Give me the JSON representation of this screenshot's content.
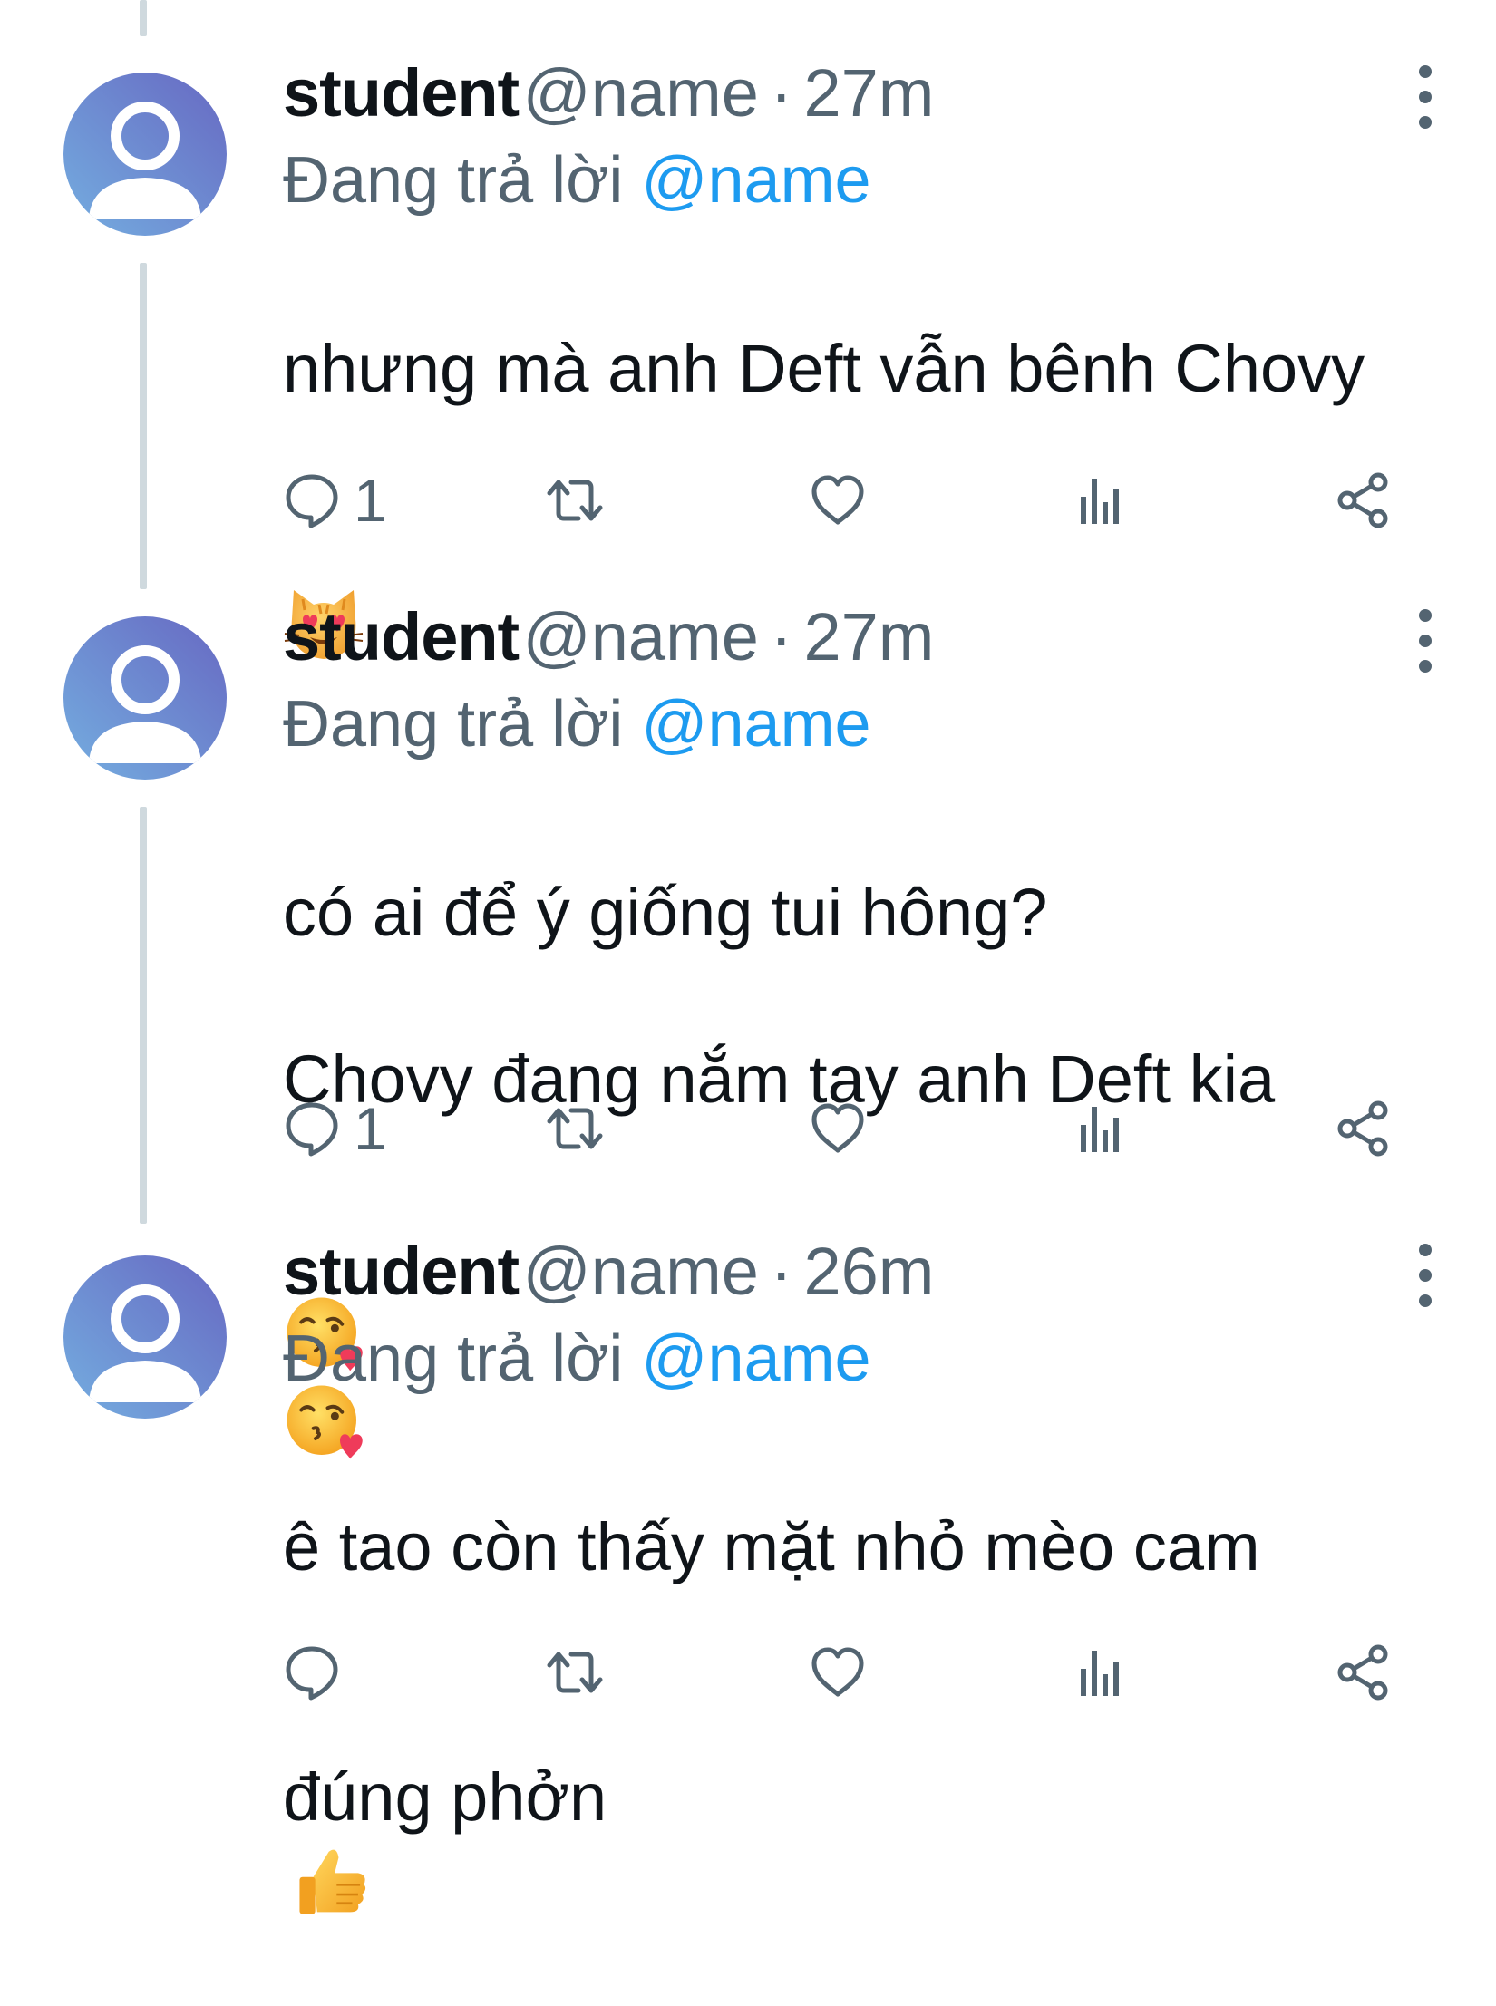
{
  "tweets": [
    {
      "name": "student",
      "handle": "@name",
      "time": "27m",
      "reply_prefix": "Đang trả lời",
      "reply_handle": "@name",
      "text": "nhưng mà anh Deft vẫn bênh Chovy",
      "emojis": [
        "smiling-cat-heart-eyes-emoji"
      ],
      "reply_count": "1",
      "icons": [
        "reply-icon",
        "retweet-icon",
        "like-icon",
        "analytics-icon",
        "share-icon"
      ]
    },
    {
      "name": "student",
      "handle": "@name",
      "time": "27m",
      "reply_prefix": "Đang trả lời",
      "reply_handle": "@name",
      "text_line1": "có ai để ý giống tui hông?",
      "text_line2": "Chovy đang nắm tay anh Deft kia",
      "emojis": [
        "face-blowing-kiss-emoji",
        "face-blowing-kiss-emoji"
      ],
      "reply_count": "1",
      "icons": [
        "reply-icon",
        "retweet-icon",
        "like-icon",
        "analytics-icon",
        "share-icon"
      ]
    },
    {
      "name": "student",
      "handle": "@name",
      "time": "26m",
      "reply_prefix": "Đang trả lời",
      "reply_handle": "@name",
      "text_line1": "ê tao còn thấy mặt nhỏ mèo cam",
      "text_line2": "đúng phởn",
      "emojis": [
        "thumbs-up-emoji"
      ],
      "reply_count": "",
      "icons": [
        "reply-icon",
        "retweet-icon",
        "like-icon",
        "analytics-icon",
        "share-icon"
      ]
    }
  ],
  "separator": "·",
  "colors": {
    "text": "#0f1419",
    "secondary": "#536471",
    "link": "#1d9bf0",
    "thread_line": "#cfd9de",
    "avatar_gradient_start": "#6fa6dc",
    "avatar_gradient_end": "#6a6fc4"
  }
}
